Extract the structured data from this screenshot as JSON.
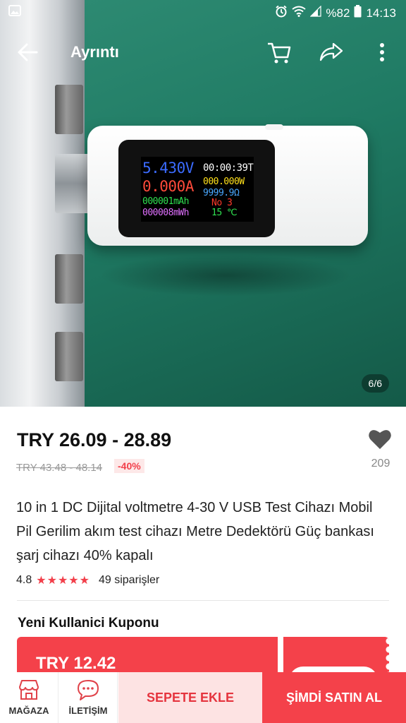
{
  "status_bar": {
    "battery": "%82",
    "time": "14:13",
    "icons": [
      "gallery-icon",
      "alarm-icon",
      "wifi-icon",
      "signal-icon",
      "battery-icon"
    ]
  },
  "app_bar": {
    "title": "Ayrıntı",
    "icons": [
      "back-arrow-icon",
      "cart-icon",
      "share-icon",
      "more-vert-icon"
    ]
  },
  "gallery": {
    "counter": "6/6",
    "meter_display": {
      "voltage": "5.430V",
      "timer": "00:00:39T",
      "current": "0.000A",
      "power": "000.000W",
      "resistance": "9999.9Ω",
      "capacity": "000001mAh",
      "number": "No 3",
      "energy": "000008mWh",
      "temperature": "15 ℃"
    }
  },
  "product": {
    "price_range": "TRY 26.09 - 28.89",
    "original_price": "TRY 43.48 - 48.14",
    "discount": "-40%",
    "wishlist_count": "209",
    "title": "10 in 1 DC Dijital voltmetre 4-30 V USB Test Cihazı Mobil Pil Gerilim akım test cihazı Metre Dedektörü Güç bankası şarj cihazı 40% kapalı",
    "rating": "4.8",
    "stars": "★★★★★",
    "orders": "49 siparişler"
  },
  "coupon": {
    "title": "Yeni Kullanici Kuponu",
    "price": "TRY 12.42"
  },
  "bottom_bar": {
    "store_label": "MAĞAZA",
    "contact_label": "İLETİŞİM",
    "add_to_cart_label": "SEPETE EKLE",
    "buy_now_label": "ŞİMDİ SATIN AL"
  },
  "colors": {
    "accent": "#f4414a",
    "accent_light": "#fde3e3",
    "star": "#f23f4a"
  }
}
